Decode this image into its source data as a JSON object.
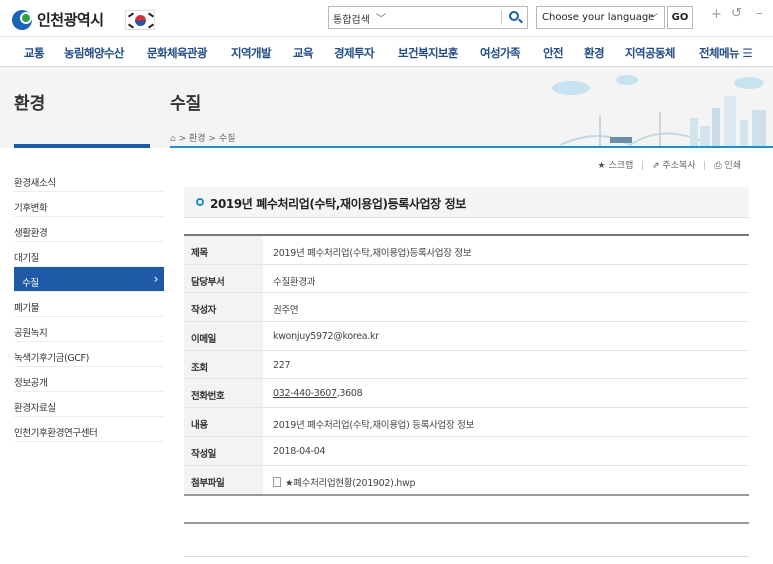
{
  "header": {
    "logo_text": "인천광역시",
    "search_scope": "통합검색",
    "language_select": "Choose your language",
    "go_label": "GO",
    "zoom_in": "+",
    "zoom_reset": "↺",
    "zoom_out": "–"
  },
  "gnb": [
    "교통",
    "농림해양수산",
    "문화체육관광",
    "지역개발",
    "교육",
    "경제투자",
    "보건복지보훈",
    "여성가족",
    "안전",
    "환경",
    "지역공동체",
    "전체메뉴 ☰"
  ],
  "section_title": "환경",
  "page_title": "수질",
  "breadcrumb": {
    "home": "⌂",
    "path": "> 환경 > 수질"
  },
  "lnb": [
    "환경새소식",
    "기후변화",
    "생활환경",
    "대기질",
    "수질",
    "폐기물",
    "공원녹지",
    "녹색기후기금(GCF)",
    "정보공개",
    "환경자료실",
    "인천기후환경연구센터"
  ],
  "lnb_active_index": 4,
  "tools": {
    "scrap": "스크랩",
    "copy_url": "주소복사",
    "print": "인쇄"
  },
  "article": {
    "title": "2019년 폐수처리업(수탁,재이용업)등록사업장 정보",
    "rows": [
      {
        "key": "제목",
        "value": "2019년 폐수처리업(수탁,재이용업)등록사업장 정보"
      },
      {
        "key": "담당부서",
        "value": "수질환경과"
      },
      {
        "key": "작성자",
        "value": "권주연"
      },
      {
        "key": "이메일",
        "value": "kwonjuy5972@korea.kr"
      },
      {
        "key": "조회",
        "value": "227"
      },
      {
        "key": "전화번호",
        "value_tel": "032-440-3607",
        "value_ext": ",3608"
      },
      {
        "key": "내용",
        "value": "2019년 폐수처리업(수탁,재이용업) 등록사업장 정보"
      },
      {
        "key": "작성일",
        "value": "2018-04-04"
      },
      {
        "key": "첨부파일",
        "value": "★폐수처리업현황(201902).hwp"
      }
    ]
  },
  "colors": {
    "brand_blue": "#1f5aa7",
    "accent_cyan": "#1d8fc9",
    "nav_text": "#224d87"
  }
}
